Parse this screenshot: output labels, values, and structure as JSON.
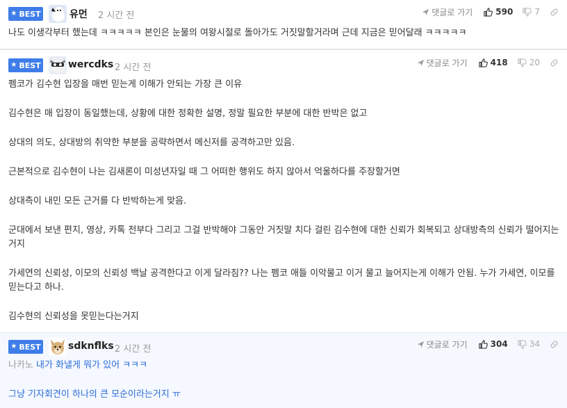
{
  "badge_label": "BEST",
  "reply_label": "댓글로 가기",
  "comments": [
    {
      "author": "유먼",
      "time": "2 시간 전",
      "upvotes": "590",
      "downvotes": "7",
      "lines": [
        "나도 이생각부터 했는데 ㅋㅋㅋㅋㅋ 본인은 눈물의 여왕시절로 돌아가도 거짓말할거라며 근데 지금은 믿어달래 ㅋㅋㅋㅋㅋ"
      ]
    },
    {
      "author": "wercdks",
      "time": "2 시간 전",
      "upvotes": "418",
      "downvotes": "20",
      "lines": [
        "펨코가 김수현 입장을 매번 믿는게 이해가 안되는 가장 큰 이유",
        "김수현은 매 입장이 동일했는데, 상황에 대한 정확한 설명, 정말 필요한 부분에 대한 반박은 없고",
        "상대의 의도, 상대방의 취약한 부분을 공략하면서 메신저를 공격하고만 있음.",
        "근본적으로 김수현이 나는 김새론이 미성년자일 때 그 어떠한 행위도 하지 않아서 억울하다를 주장할거면",
        "상대측이 내민 모든 근거를 다 반박하는게 맞음.",
        "군대에서 보낸 편지, 영상, 카톡 전부다 그리고 그걸 반박해야 그동안 거짓말 치다 걸린 김수현에 대한 신뢰가 회복되고 상대방측의 신뢰가 떨어지는 거지",
        "가세연의 신뢰성, 이모의 신뢰성 백날 공격한다고 이게 달라짐?? 나는 펨코 애들 이악물고 이거 물고 늘어지는게 이해가 안됨. 누가 가세연, 이모를 믿는다고 하나.",
        "김수현의 신뢰성을 못믿는다는거지"
      ]
    },
    {
      "author": "sdknflks",
      "time": "2 시간 전",
      "upvotes": "304",
      "downvotes": "34",
      "reply_to": "나카노",
      "lines": [
        "내가 화낼게 뭐가 있어 ㅋㅋㅋ",
        "그냥 기자회견이 하나의 큰 모순이라는거지 ㅠ"
      ]
    }
  ],
  "icons": {
    "badge": "star-icon",
    "reply": "reply-arrow-icon",
    "upvote": "thumbs-up-icon",
    "downvote": "thumbs-down-icon",
    "link": "link-icon"
  },
  "colors": {
    "badge_bg": "#3f7de8",
    "reply_text_blue": "#2a6cd6",
    "best_row_bg": "#f5f8ff"
  }
}
